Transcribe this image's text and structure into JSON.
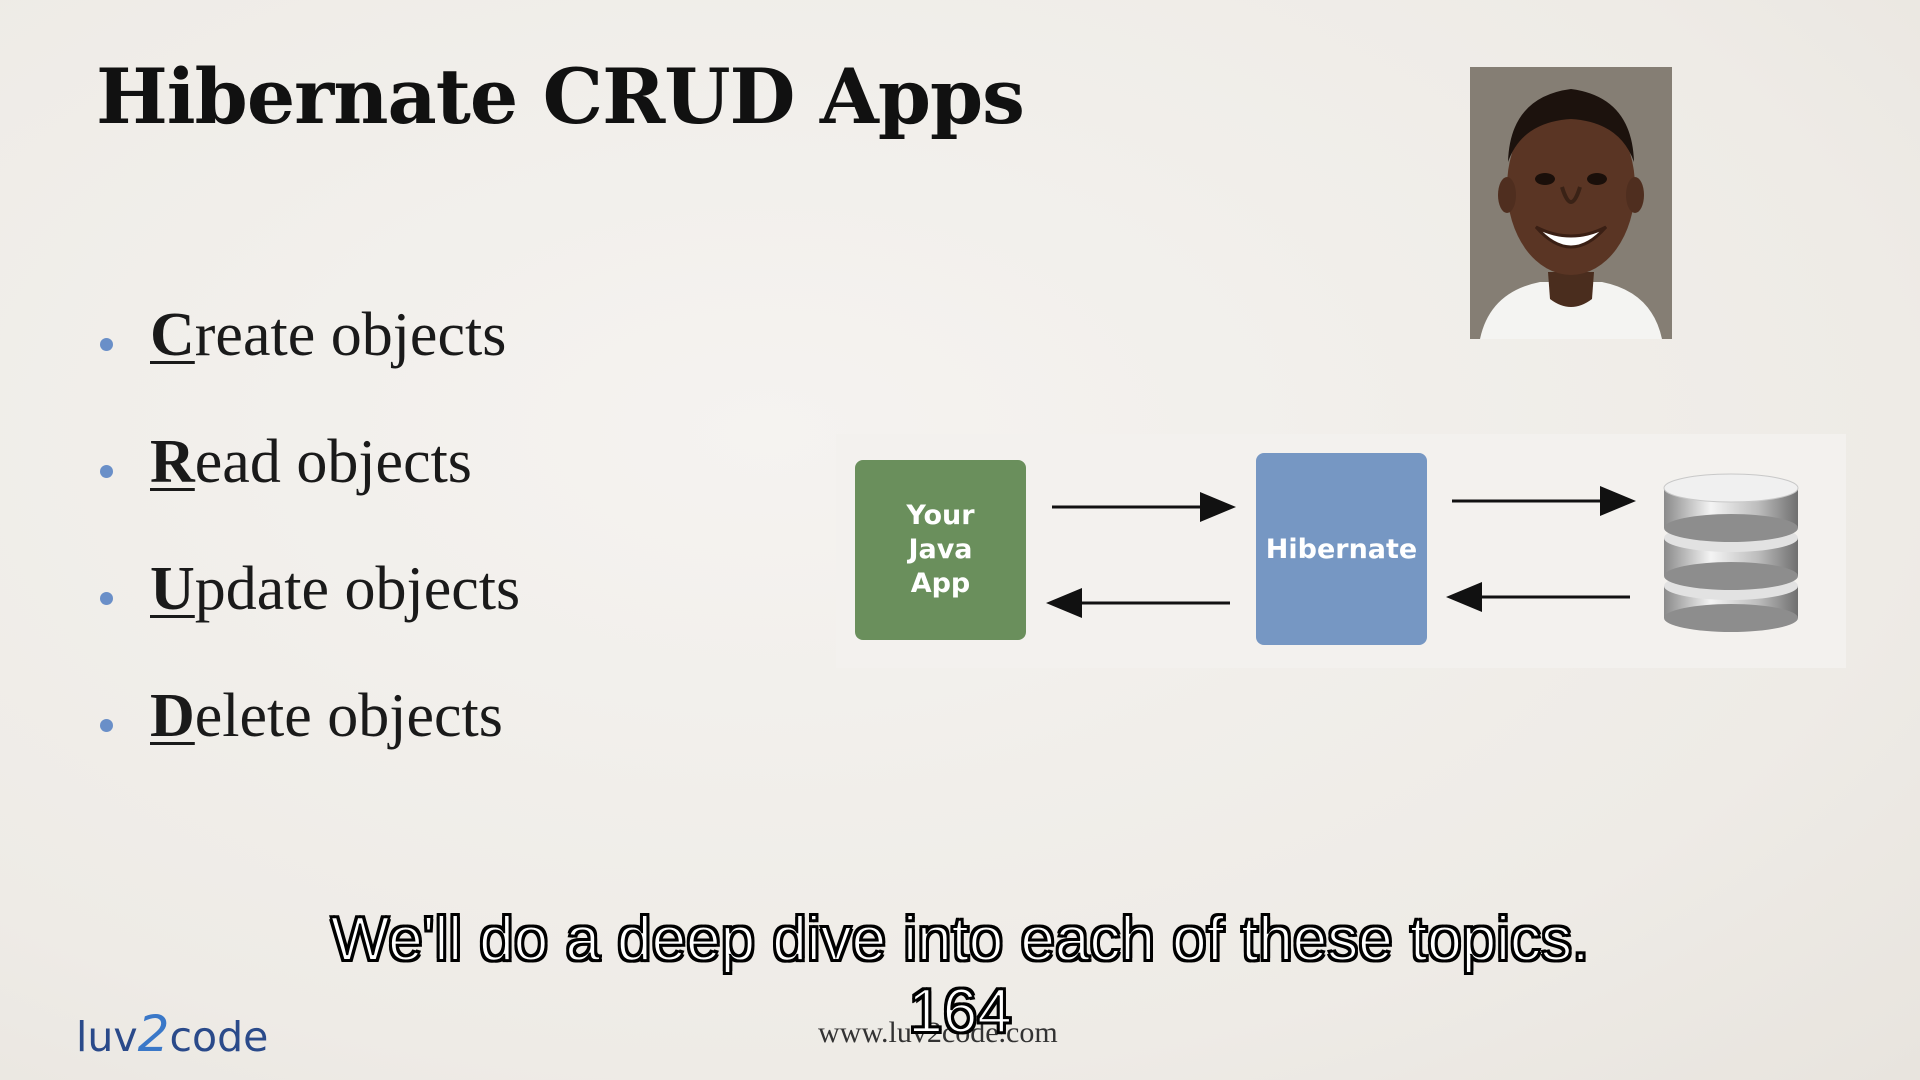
{
  "slide": {
    "title": "Hibernate CRUD Apps",
    "bullets": [
      {
        "first": "C",
        "rest": "reate objects"
      },
      {
        "first": "R",
        "rest": "ead objects"
      },
      {
        "first": "U",
        "rest": "pdate objects"
      },
      {
        "first": "D",
        "rest": "elete objects"
      }
    ]
  },
  "diagram": {
    "app_box": [
      "Your",
      "Java",
      "App"
    ],
    "hibernate_box": "Hibernate",
    "colors": {
      "app": "#6a8f5c",
      "hibernate": "#7697c3",
      "bullet_dot": "#6a8fc8"
    }
  },
  "footer": {
    "logo_left": "luv",
    "logo_two": "2",
    "logo_right": "code",
    "url": "www.luv2code.com"
  },
  "subtitle": {
    "line1": "We'll do a deep dive into each of these topics.",
    "line2": "164"
  }
}
